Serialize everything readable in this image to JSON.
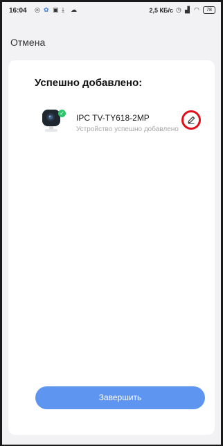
{
  "status_bar": {
    "time": "16:04",
    "speed": "2,5 КБ/с",
    "battery": "78"
  },
  "header": {
    "cancel_label": "Отмена"
  },
  "card": {
    "title": "Успешно добавлено:",
    "device": {
      "name": "IPC TV-TY618-2MP",
      "status": "Устройство успешно добавлено",
      "icon": "camera-icon",
      "badge_icon": "check-icon"
    },
    "edit_icon": "pencil-icon"
  },
  "footer": {
    "finish_label": "Завершить"
  },
  "colors": {
    "accent": "#5e95f1",
    "success": "#2ec56b",
    "annotation": "#e0101a"
  }
}
